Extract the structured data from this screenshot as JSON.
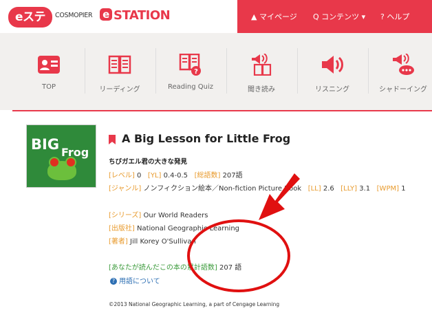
{
  "header": {
    "logo_text": "eステ",
    "brand_text": "COSMOPIER",
    "station_e": "e",
    "station_text": "STATION",
    "nav": [
      {
        "label": "▲ マイページ",
        "icon": "person-icon"
      },
      {
        "label": "Q コンテンツ ▾",
        "icon": "search-icon"
      },
      {
        "label": "? ヘルプ",
        "icon": "help-icon"
      }
    ],
    "accent": "#e8384a"
  },
  "menu": [
    {
      "label": "TOP",
      "icon": "id-card-icon"
    },
    {
      "label": "リーディング",
      "icon": "open-book-icon"
    },
    {
      "label": "Reading Quiz",
      "icon": "book-quiz-icon"
    },
    {
      "label": "聞き読み",
      "icon": "audio-book-icon"
    },
    {
      "label": "リスニング",
      "icon": "speaker-icon"
    },
    {
      "label": "シャドーイング",
      "icon": "speaking-icon"
    }
  ],
  "book": {
    "cover_title_1": "BIG",
    "cover_title_2": "Frog",
    "title": "A Big Lesson for Little Frog",
    "subtitle": "ちびガエル君の大きな発見",
    "level_key": "[レベル]",
    "level_val": "0",
    "yl_key": "[YL]",
    "yl_val": "0.4-0.5",
    "words_key": "[総語数]",
    "words_val": "207語",
    "genre_key": "[ジャンル]",
    "genre_val": "ノンフィクション絵本／Non-fiction Picture Book",
    "ll_key": "[LL]",
    "ll_val": "2.6",
    "lly_key": "[LLY]",
    "lly_val": "3.1",
    "wpm_key": "[WPM]",
    "wpm_val": "1",
    "series_key": "[シリーズ]",
    "series_val": "Our World Readers",
    "publisher_key": "[出版社]",
    "publisher_val": "National Geographic Learning",
    "author_key": "[著者]",
    "author_val": "Jill Korey O'Sullivan",
    "cumulative_key": "[あなたが読んだこの本の累計語数]",
    "cumulative_val": "207 語",
    "help_link": "用語について",
    "copyright": "©2013 National Geographic Learning, a part of Cengage Learning"
  }
}
